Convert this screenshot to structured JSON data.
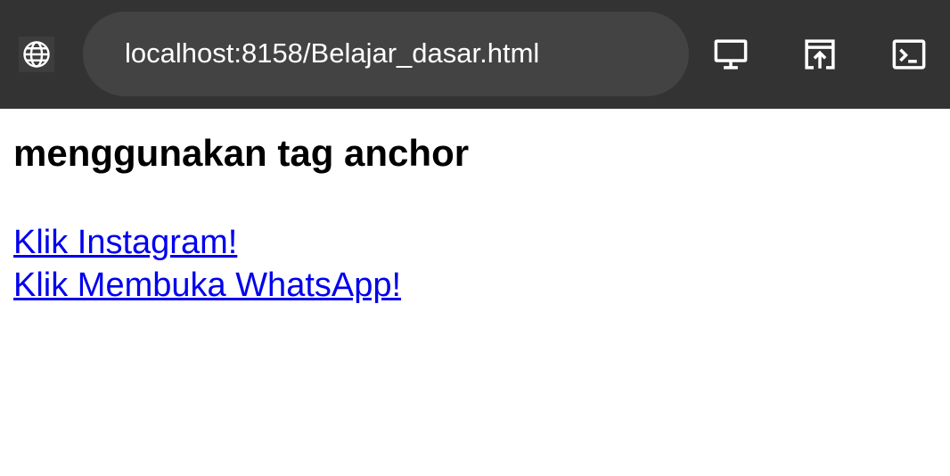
{
  "browser": {
    "url": "localhost:8158/Belajar_dasar.html",
    "icons": {
      "site": "globe-icon",
      "desktop": "desktop-icon",
      "open_external": "open-in-new-icon",
      "devtools": "terminal-icon"
    }
  },
  "page": {
    "heading": "menggunakan tag anchor",
    "links": [
      {
        "label": "Klik Instagram!"
      },
      {
        "label": "Klik Membuka WhatsApp!"
      }
    ]
  },
  "colors": {
    "toolbar_bg": "#333333",
    "url_bar_bg": "#434343",
    "link": "#0000ee",
    "heading": "#000000"
  }
}
